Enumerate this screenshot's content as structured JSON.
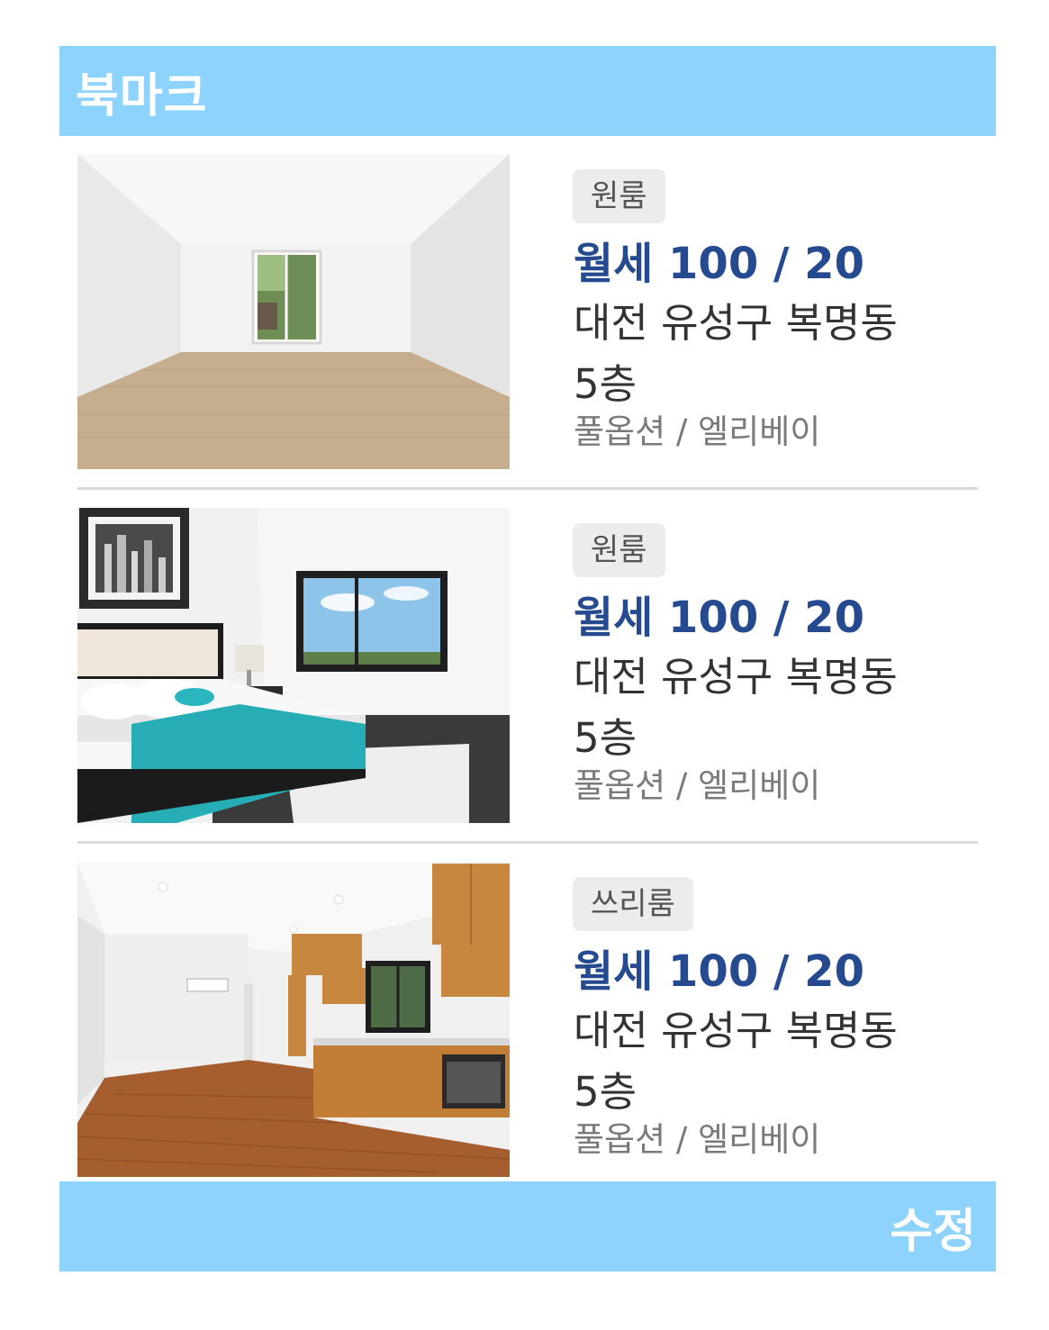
{
  "header": {
    "title": "북마크"
  },
  "listings": [
    {
      "type": "원룸",
      "price": "월세 100 / 20",
      "address": "대전 유성구 복명동",
      "floor": "5층",
      "options": "풀옵션 / 엘리베이"
    },
    {
      "type": "원룸",
      "price": "월세 100 / 20",
      "address": "대전 유성구 복명동",
      "floor": "5층",
      "options": "풀옵션 / 엘리베이"
    },
    {
      "type": "쓰리룸",
      "price": "월세 100 / 20",
      "address": "대전 유성구 복명동",
      "floor": "5층",
      "options": "풀옵션 / 엘리베이"
    }
  ],
  "footer": {
    "edit_label": "수정"
  },
  "colors": {
    "accent_bar": "#8ed3fd",
    "price_text": "#254a8f",
    "badge_bg": "#ececec"
  }
}
